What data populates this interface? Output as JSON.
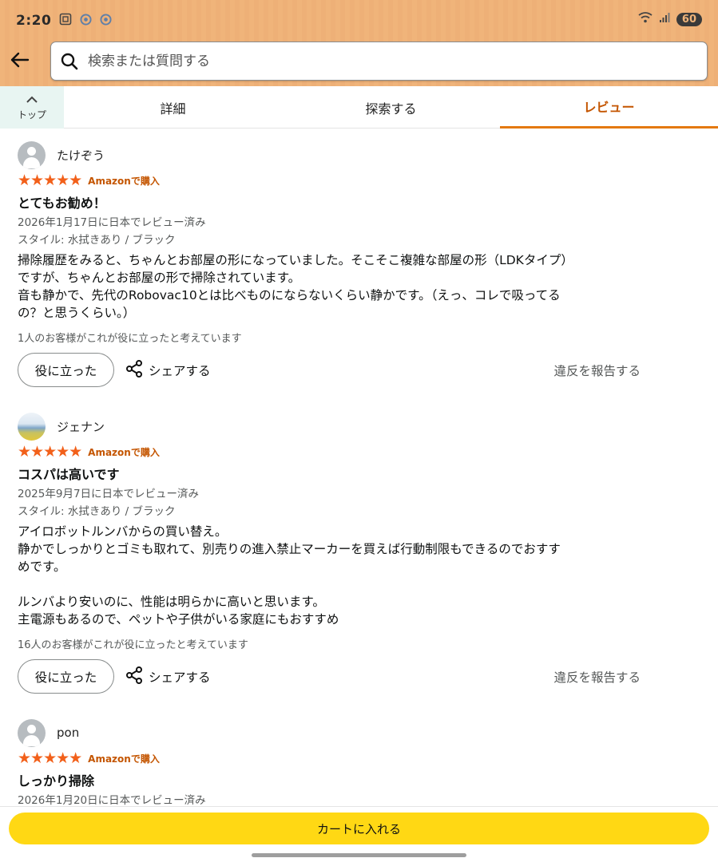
{
  "status_bar": {
    "time": "2:20",
    "icons": [
      "screenshot-icon",
      "chrome-icon",
      "chrome-icon"
    ],
    "battery": "60"
  },
  "search": {
    "placeholder": "検索または質問する"
  },
  "tabs": {
    "top_label": "トップ",
    "items": [
      {
        "label": "詳細"
      },
      {
        "label": "探索する"
      },
      {
        "label": "レビュー"
      }
    ]
  },
  "reviews": [
    {
      "name": "たけぞう",
      "stars": "★★★★★",
      "verified": "Amazonで購入",
      "title": "とてもお勧め！",
      "date": "2026年1月17日に日本でレビュー済み",
      "style": "スタイル: 水拭きあり / ブラック",
      "body": "掃除履歴をみると、ちゃんとお部屋の形になっていました。そこそこ複雑な部屋の形（LDKタイプ）\nですが、ちゃんとお部屋の形で掃除されています。\n音も静かで、先代のRobovac10とは比べものにならないくらい静かです。（えっ、コレで吸ってる\nの？と思うくらい。）",
      "helpful_count": "1人のお客様がこれが役に立ったと考えています",
      "helpful_button": "役に立った",
      "share_label": "シェアする",
      "report_label": "違反を報告する"
    },
    {
      "name": "ジェナン",
      "stars": "★★★★★",
      "verified": "Amazonで購入",
      "title": "コスパは高いです",
      "date": "2025年9月7日に日本でレビュー済み",
      "style": "スタイル: 水拭きあり / ブラック",
      "body": "アイロボットルンバからの買い替え。\n静かでしっかりとゴミも取れて、別売りの進入禁止マーカーを買えば行動制限もできるのでおすす\nめです。\n\nルンバより安いのに、性能は明らかに高いと思います。\n主電源もあるので、ペットや子供がいる家庭にもおすすめ",
      "helpful_count": "16人のお客様がこれが役に立ったと考えています",
      "helpful_button": "役に立った",
      "share_label": "シェアする",
      "report_label": "違反を報告する"
    },
    {
      "name": "pon",
      "stars": "★★★★★",
      "verified": "Amazonで購入",
      "title": "しっかり掃除",
      "date": "2026年1月20日に日本でレビュー済み"
    }
  ],
  "cart": {
    "label": "カートに入れる"
  },
  "colors": {
    "topbar": "#f0b47a",
    "accent": "#e47911",
    "star": "#f2601a",
    "cart": "#ffd814"
  }
}
